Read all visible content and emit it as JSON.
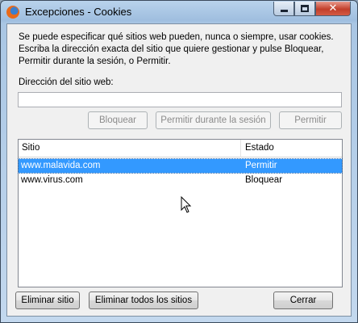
{
  "window": {
    "title": "Excepciones - Cookies"
  },
  "description": "Se puede especificar qué sitios web pueden, nunca o siempre, usar cookies. Escriba la dirección exacta del sitio que quiere gestionar y pulse Bloquear, Permitir durante la sesión, o Permitir.",
  "site_field": {
    "label": "Dirección del sitio web:",
    "value": ""
  },
  "buttons": {
    "block": "Bloquear",
    "allow_session": "Permitir durante la sesión",
    "allow": "Permitir",
    "remove_site": "Eliminar sitio",
    "remove_all": "Eliminar todos los sitios",
    "close": "Cerrar"
  },
  "table": {
    "columns": [
      "Sitio",
      "Estado"
    ],
    "rows": [
      {
        "site": "www.malavida.com",
        "status": "Permitir",
        "selected": true
      },
      {
        "site": "www.virus.com",
        "status": "Bloquear",
        "selected": false
      }
    ]
  },
  "icons": [
    "firefox-icon",
    "minimize-icon",
    "maximize-icon",
    "close-icon",
    "mouse-cursor-icon"
  ],
  "colors": {
    "selection": "#3399ff",
    "titlebar": "#a9c6e4",
    "close_button": "#c23f2b"
  }
}
